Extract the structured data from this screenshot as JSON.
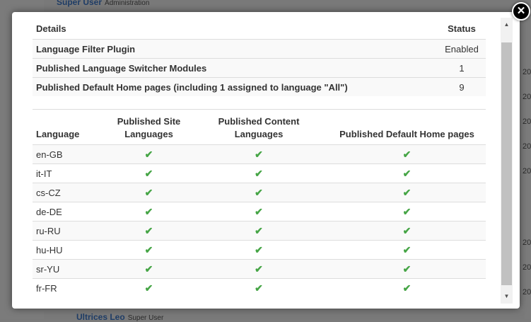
{
  "background": {
    "top_item": {
      "title": "Super User",
      "subtitle": "Administration"
    },
    "bottom_item": {
      "title": "Ultrices Leo",
      "subtitle": "Super User"
    },
    "side_numbers": [
      "20",
      "20",
      "20",
      "20",
      "20",
      "20",
      "20",
      "20"
    ]
  },
  "summary": {
    "headers": {
      "details": "Details",
      "status": "Status"
    },
    "rows": [
      {
        "label": "Language Filter Plugin",
        "value": "Enabled"
      },
      {
        "label": "Published Language Switcher Modules",
        "value": "1"
      },
      {
        "label": "Published Default Home pages (including 1 assigned to language \"All\")",
        "value": "9"
      }
    ]
  },
  "languages": {
    "headers": {
      "language": "Language",
      "site_line1": "Published Site",
      "site_line2": "Languages",
      "content": "Published Content Languages",
      "home": "Published Default Home pages"
    },
    "check_icon": "check-icon",
    "check_color": "#46a546",
    "rows": [
      {
        "code": "en-GB",
        "site": "✔",
        "content": "✔",
        "home": "✔"
      },
      {
        "code": "it-IT",
        "site": "✔",
        "content": "✔",
        "home": "✔"
      },
      {
        "code": "cs-CZ",
        "site": "✔",
        "content": "✔",
        "home": "✔"
      },
      {
        "code": "de-DE",
        "site": "✔",
        "content": "✔",
        "home": "✔"
      },
      {
        "code": "ru-RU",
        "site": "✔",
        "content": "✔",
        "home": "✔"
      },
      {
        "code": "hu-HU",
        "site": "✔",
        "content": "✔",
        "home": "✔"
      },
      {
        "code": "sr-YU",
        "site": "✔",
        "content": "✔",
        "home": "✔"
      },
      {
        "code": "fr-FR",
        "site": "✔",
        "content": "✔",
        "home": "✔"
      }
    ]
  },
  "controls": {
    "close_symbol": "✕",
    "scroll_up_symbol": "▲",
    "scroll_down_symbol": "▼"
  }
}
